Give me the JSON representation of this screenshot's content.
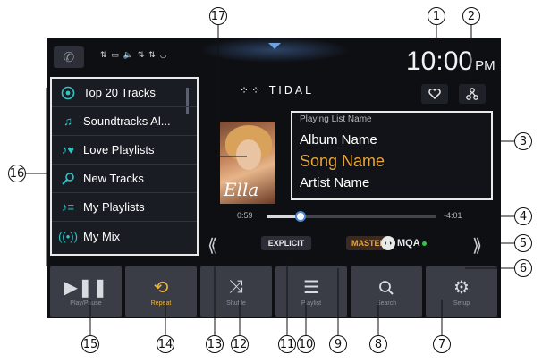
{
  "status": {
    "time": "10:00",
    "ampm": "PM",
    "icons_text": "⇅ ▭ 🔈 ⇅ ⇅ ◡"
  },
  "brand": {
    "name": "TIDAL"
  },
  "playlist": {
    "items": [
      {
        "label": "Top 20 Tracks",
        "icon": "target-icon"
      },
      {
        "label": "Soundtracks Al...",
        "icon": "music-note-icon"
      },
      {
        "label": "Love Playlists",
        "icon": "love-playlist-icon"
      },
      {
        "label": "New Tracks",
        "icon": "new-tracks-icon"
      },
      {
        "label": "My Playlists",
        "icon": "playlist-icon"
      },
      {
        "label": "My Mix",
        "icon": "mix-icon"
      }
    ]
  },
  "album_art": {
    "signature": "Ella"
  },
  "now_playing": {
    "playing_list_name": "Playing List Name",
    "album": "Album Name",
    "song": "Song Name",
    "artist": "Artist Name",
    "song_color": "#e9a53a"
  },
  "progress": {
    "elapsed": "0:59",
    "remaining": "-4:01",
    "fraction": 0.2
  },
  "badges": {
    "explicit": "EXPLICIT",
    "master": "MASTER",
    "mqa": "MQA"
  },
  "bottom_bar": [
    {
      "label": "Play/Pause",
      "icon": "play-pause-icon"
    },
    {
      "label": "Repeat",
      "icon": "repeat-icon",
      "active": true
    },
    {
      "label": "Shuffle",
      "icon": "shuffle-icon"
    },
    {
      "label": "Playlist",
      "icon": "list-icon"
    },
    {
      "label": "Search",
      "icon": "search-icon"
    },
    {
      "label": "Setup",
      "icon": "gear-icon"
    }
  ],
  "callouts": [
    "1",
    "2",
    "3",
    "4",
    "5",
    "6",
    "7",
    "8",
    "9",
    "10",
    "11",
    "12",
    "13",
    "14",
    "15",
    "16",
    "17"
  ],
  "colors": {
    "accent": "#e9a53a",
    "teal": "#2ec5c5",
    "progress_knob": "#4c8ad9"
  }
}
